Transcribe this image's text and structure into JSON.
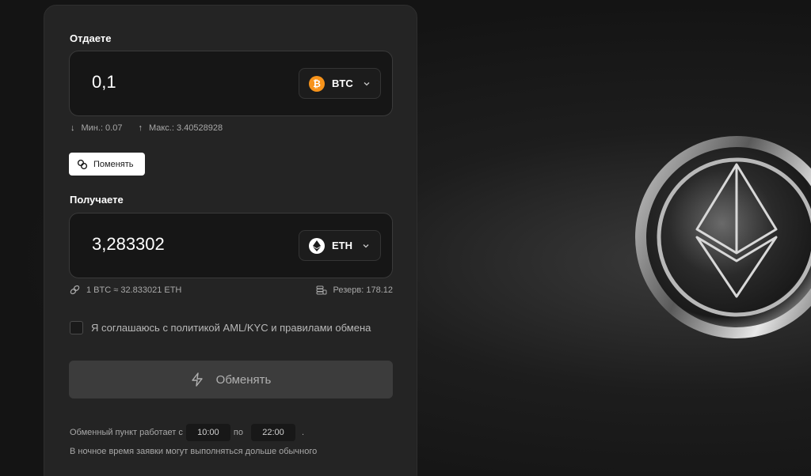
{
  "give": {
    "label": "Отдаете",
    "amount": "0,1",
    "currency": "BTC",
    "min": "Мин.: 0.07",
    "max": "Макс.: 3.40528928"
  },
  "swap": {
    "label": "Поменять"
  },
  "receive": {
    "label": "Получаете",
    "amount": "3,283302",
    "currency": "ETH",
    "rate": "1 BTC ≈ 32.833021 ETH",
    "reserve": "Резерв: 178.12"
  },
  "agreement": {
    "label": "Я соглашаюсь с политикой AML/KYC и правилами обмена"
  },
  "exchange_button": {
    "label": "Обменять"
  },
  "hours": {
    "prefix": "Обменный пункт работает с",
    "from": "10:00",
    "middle": "по",
    "to": "22:00",
    "suffix": ".",
    "note": "В ночное время заявки могут выполняться дольше обычного"
  },
  "icons": {
    "btc": "bitcoin-icon",
    "eth": "ethereum-icon",
    "swap": "swap-icon",
    "exchange": "lightning-icon",
    "rate": "link-icon",
    "reserve": "coins-stack-icon"
  },
  "colors": {
    "background": "#141414",
    "card": "#242424",
    "btc_orange": "#f7931a",
    "button_disabled": "#3c3c3c"
  }
}
